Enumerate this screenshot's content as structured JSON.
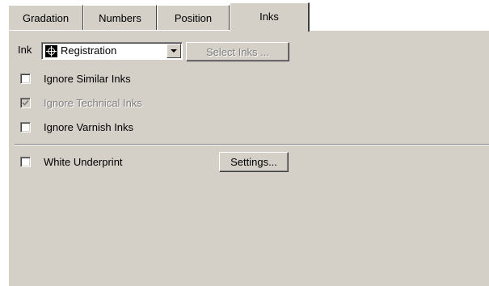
{
  "tabs": [
    {
      "label": "Gradation"
    },
    {
      "label": "Numbers"
    },
    {
      "label": "Position"
    },
    {
      "label": "Inks",
      "active": true
    }
  ],
  "ink": {
    "label": "Ink",
    "selected_value": "Registration",
    "icon": "registration-mark-icon",
    "select_inks_label": "Select Inks ...",
    "select_inks_enabled": false
  },
  "options": {
    "ignore_similar": {
      "label": "Ignore Similar Inks",
      "checked": false,
      "enabled": true
    },
    "ignore_technical": {
      "label": "Ignore Technical Inks",
      "checked": true,
      "enabled": false
    },
    "ignore_varnish": {
      "label": "Ignore Varnish Inks",
      "checked": false,
      "enabled": true
    }
  },
  "underprint": {
    "label": "White Underprint",
    "checked": false,
    "settings_label": "Settings..."
  },
  "colors": {
    "panel": "#d4d0c8",
    "disabled_text": "#808080"
  }
}
